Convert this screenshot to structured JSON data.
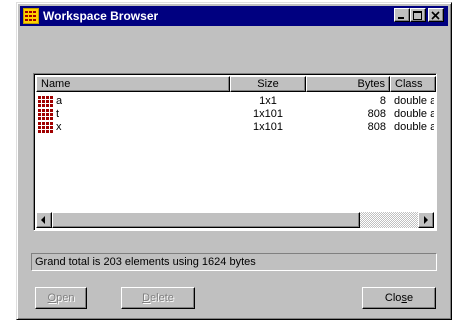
{
  "window": {
    "title": "Workspace Browser",
    "controls": [
      "minimize-icon",
      "maximize-icon",
      "close-icon"
    ]
  },
  "list": {
    "columns": [
      "Name",
      "Size",
      "Bytes",
      "Class"
    ],
    "rows": [
      {
        "name": "a",
        "size": "1x1",
        "bytes": "8",
        "class": "double arr"
      },
      {
        "name": "t",
        "size": "1x101",
        "bytes": "808",
        "class": "double arr"
      },
      {
        "name": "x",
        "size": "1x101",
        "bytes": "808",
        "class": "double arr"
      }
    ],
    "row_icon": "matrix-variable-icon"
  },
  "status": {
    "text": "Grand total is 203 elements using 1624 bytes"
  },
  "buttons": {
    "open": {
      "label_prefix": "",
      "mnemonic": "O",
      "label_suffix": "pen",
      "enabled": false
    },
    "delete": {
      "label_prefix": "",
      "mnemonic": "D",
      "label_suffix": "elete",
      "enabled": false
    },
    "close": {
      "label_prefix": "Clo",
      "mnemonic": "s",
      "label_suffix": "e",
      "enabled": true
    }
  },
  "colors": {
    "titlebar": "#000080",
    "face": "#c0c0c0",
    "icon_red": "#a00000"
  }
}
